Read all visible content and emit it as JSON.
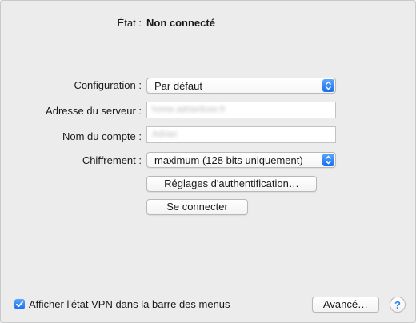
{
  "status": {
    "label": "État :",
    "value": "Non connecté"
  },
  "configuration": {
    "label": "Configuration :",
    "value": "Par défaut"
  },
  "server_address": {
    "label": "Adresse du serveur :",
    "value": "home.adrianfuse.fr"
  },
  "account_name": {
    "label": "Nom du compte :",
    "value": "Adrian"
  },
  "encryption": {
    "label": "Chiffrement :",
    "value": "maximum (128 bits uniquement)"
  },
  "buttons": {
    "auth_settings": "Réglages d'authentification…",
    "connect": "Se connecter",
    "advanced": "Avancé…",
    "help": "?"
  },
  "show_vpn_status": {
    "label": "Afficher l'état VPN dans la barre des menus",
    "checked": true
  },
  "colors": {
    "accent": "#1a6ef1",
    "window_bg": "#ececec"
  },
  "icons": {
    "popup": "chevron-up-down-icon",
    "checkbox": "checkmark-icon",
    "help": "question-mark-icon"
  }
}
